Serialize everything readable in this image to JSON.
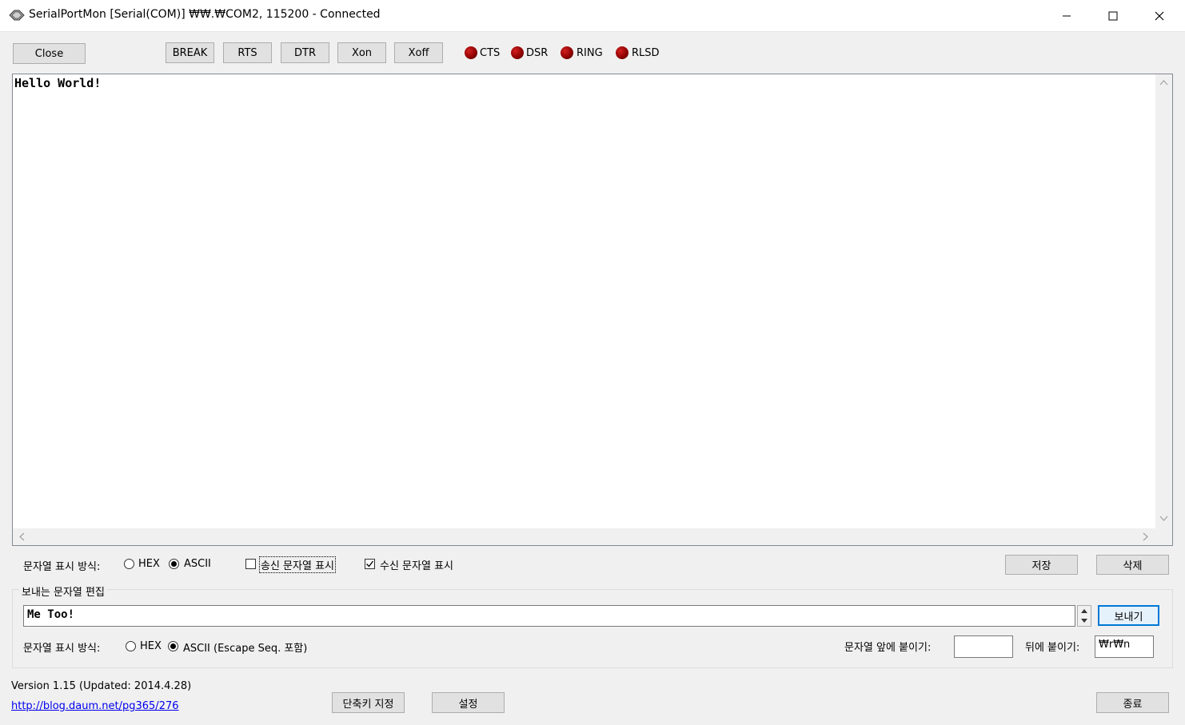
{
  "window": {
    "title": "SerialPortMon [Serial(COM)] ₩₩.₩COM2, 115200 - Connected",
    "minimize": "—",
    "maximize": "☐",
    "close": "✕"
  },
  "toolbar": {
    "close_label": "Close",
    "break_label": "BREAK",
    "rts_label": "RTS",
    "dtr_label": "DTR",
    "xon_label": "Xon",
    "xoff_label": "Xoff"
  },
  "signals": [
    {
      "label": "CTS",
      "color": "#c00000"
    },
    {
      "label": "DSR",
      "color": "#c00000"
    },
    {
      "label": "RING",
      "color": "#c00000"
    },
    {
      "label": "RLSD",
      "color": "#c00000"
    }
  ],
  "receive": {
    "text": "Hello World!"
  },
  "display_options": {
    "label": "문자열 표시 방식:",
    "hex_label": "HEX",
    "ascii_label": "ASCII",
    "selected": "ASCII",
    "show_sent_label": "송신 문자열 표시",
    "show_sent_checked": false,
    "show_recv_label": "수신 문자열 표시",
    "show_recv_checked": true,
    "save_label": "저장",
    "delete_label": "삭제"
  },
  "send_group": {
    "title": "보내는 문자열 편집",
    "input_value": "Me Too!",
    "send_label": "보내기",
    "format_label": "문자열 표시 방식:",
    "hex_label": "HEX",
    "ascii_label": "ASCII (Escape Seq. 포함)",
    "selected": "ASCII",
    "prefix_label": "문자열 앞에 붙이기:",
    "prefix_value": "",
    "suffix_label": "뒤에 붙이기:",
    "suffix_value": "₩r₩n"
  },
  "footer": {
    "version": "Version 1.15 (Updated: 2014.4.28)",
    "link": "http://blog.daum.net/pg365/276",
    "shortcut_label": "단축키 지정",
    "settings_label": "설정",
    "exit_label": "종료"
  },
  "colors": {
    "window_bg": "#f0f0f0",
    "button_bg": "#e1e1e1",
    "led_red": "#c00000",
    "focus_border": "#0078d7"
  }
}
